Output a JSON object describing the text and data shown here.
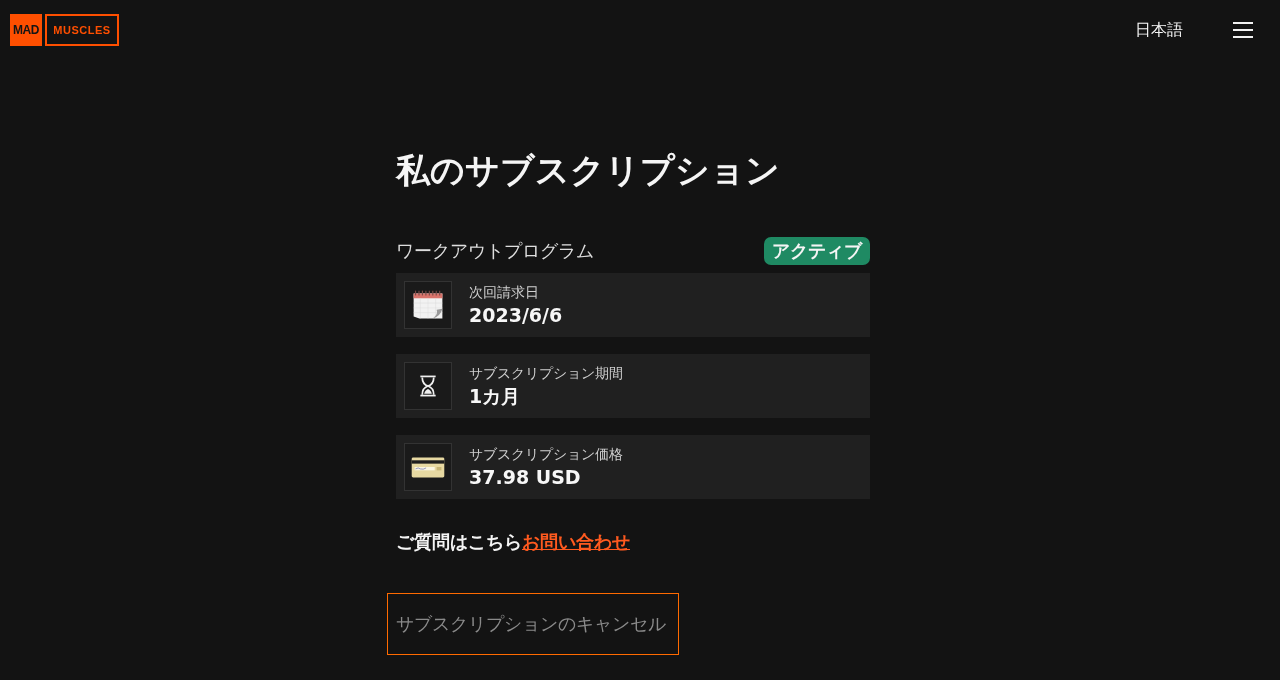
{
  "header": {
    "logo": {
      "mark": "MAD",
      "wordmark": "MUSCLES"
    },
    "language": "日本語"
  },
  "title": "私のサブスクリプション",
  "subscription": {
    "name": "ワークアウトプログラム",
    "status": {
      "label": "アクティブ",
      "active": true
    },
    "details": [
      {
        "kind": "calendar",
        "label": "次回請求日",
        "value": "2023/6/6"
      },
      {
        "kind": "hourglass",
        "label": "サブスクリプション期間",
        "value": "1カ月"
      },
      {
        "kind": "card",
        "label": "サブスクリプション価格",
        "value": "37.98 USD"
      }
    ]
  },
  "contact": {
    "text": "ご質問はこちら",
    "link": "お問い合わせ"
  },
  "cancel_button": "サブスクリプションのキャンセル"
}
